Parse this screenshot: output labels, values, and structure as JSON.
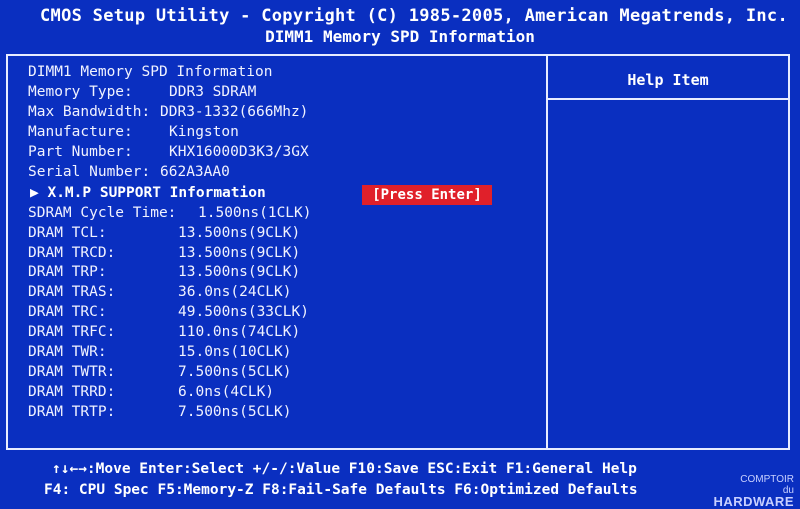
{
  "header": {
    "title": "CMOS Setup Utility - Copyright (C) 1985-2005, American Megatrends, Inc.",
    "subtitle": "DIMM1 Memory SPD Information"
  },
  "help": {
    "title": "Help Item"
  },
  "info": {
    "heading": "DIMM1 Memory SPD Information",
    "memory_type_label": "Memory Type:",
    "memory_type_value": "DDR3 SDRAM",
    "max_bandwidth_label": "Max Bandwidth:",
    "max_bandwidth_value": "DDR3-1332(666Mhz)",
    "manufacture_label": "Manufacture:",
    "manufacture_value": "Kingston",
    "part_number_label": "Part Number:",
    "part_number_value": "KHX16000D3K3/3GX",
    "serial_number_label": "Serial Number:",
    "serial_number_value": "662A3AA0",
    "xmp_label": "▶ X.M.P SUPPORT Information",
    "xmp_action": "[Press Enter]",
    "cycle_time_label": "SDRAM Cycle Time:",
    "cycle_time_value": "1.500ns(1CLK)"
  },
  "timings": [
    {
      "label": "DRAM TCL:",
      "value": "13.500ns(9CLK)"
    },
    {
      "label": "DRAM TRCD:",
      "value": "13.500ns(9CLK)"
    },
    {
      "label": "DRAM TRP:",
      "value": "13.500ns(9CLK)"
    },
    {
      "label": "DRAM TRAS:",
      "value": "36.0ns(24CLK)"
    },
    {
      "label": "DRAM TRC:",
      "value": "49.500ns(33CLK)"
    },
    {
      "label": "DRAM TRFC:",
      "value": "110.0ns(74CLK)"
    },
    {
      "label": "DRAM TWR:",
      "value": "15.0ns(10CLK)"
    },
    {
      "label": "DRAM TWTR:",
      "value": "7.500ns(5CLK)"
    },
    {
      "label": "DRAM TRRD:",
      "value": "6.0ns(4CLK)"
    },
    {
      "label": "DRAM TRTP:",
      "value": "7.500ns(5CLK)"
    }
  ],
  "footer": {
    "line1": "↑↓←→:Move  Enter:Select  +/-/:Value  F10:Save  ESC:Exit  F1:General Help",
    "line2": "F4: CPU Spec   F5:Memory-Z   F8:Fail-Safe Defaults   F6:Optimized Defaults"
  },
  "watermark": {
    "line1": "COMPTOIR",
    "line2": "du",
    "line3": "HARDWARE"
  }
}
